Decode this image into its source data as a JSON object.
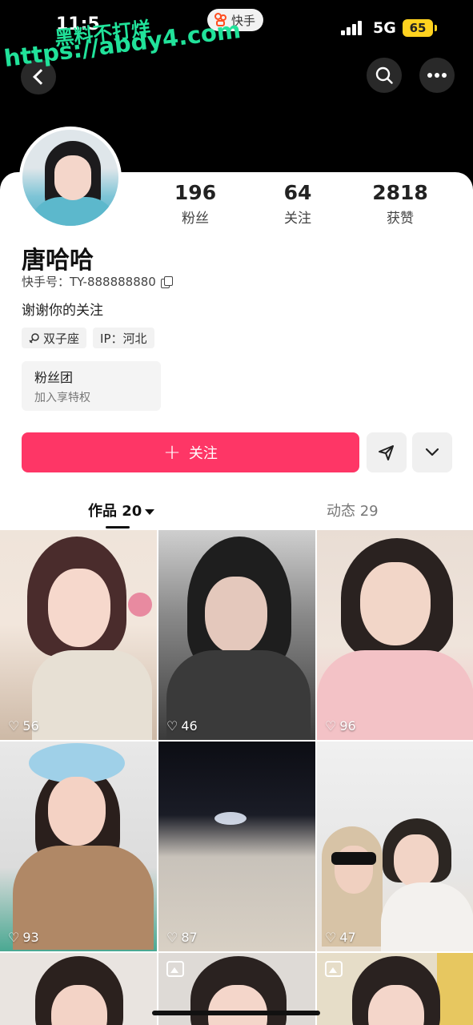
{
  "status_bar": {
    "time": "11:5",
    "network": "5G",
    "battery": "65"
  },
  "app_pill": {
    "label": "快手"
  },
  "watermark": {
    "line1": "黑料不打烊",
    "line2": "https://abdy4.com"
  },
  "header": {
    "back_icon": "chevron-left-icon",
    "search_icon": "search-icon",
    "more_icon": "more-horizontal-icon"
  },
  "profile": {
    "stats": [
      {
        "value": "196",
        "label": "粉丝"
      },
      {
        "value": "64",
        "label": "关注"
      },
      {
        "value": "2818",
        "label": "获赞"
      }
    ],
    "name": "唐哈哈",
    "uid": "快手号：TY-888888880",
    "bio": "谢谢你的关注",
    "tags": [
      {
        "icon": "zodiac-icon",
        "label": "双子座"
      },
      {
        "label": "IP：河北"
      }
    ],
    "fan_group": {
      "title": "粉丝团",
      "subtitle": "加入享特权"
    }
  },
  "actions": {
    "follow_label": "关注",
    "share_icon": "send-icon",
    "expand_icon": "chevron-down-icon"
  },
  "tabs": [
    {
      "label": "作品 20",
      "active": true
    },
    {
      "label": "动态 29",
      "active": false
    }
  ],
  "works": [
    {
      "likes": "56"
    },
    {
      "likes": "46"
    },
    {
      "likes": "96"
    },
    {
      "likes": "93"
    },
    {
      "likes": "87"
    },
    {
      "likes": "47"
    },
    {
      "likes": "",
      "type": "image"
    },
    {
      "likes": "",
      "type": "image"
    },
    {
      "likes": "",
      "type": "image"
    }
  ],
  "colors": {
    "follow_button": "#fe3666",
    "header_bg": "#000000",
    "watermark": "#21e29a",
    "battery": "#ffd21f"
  }
}
